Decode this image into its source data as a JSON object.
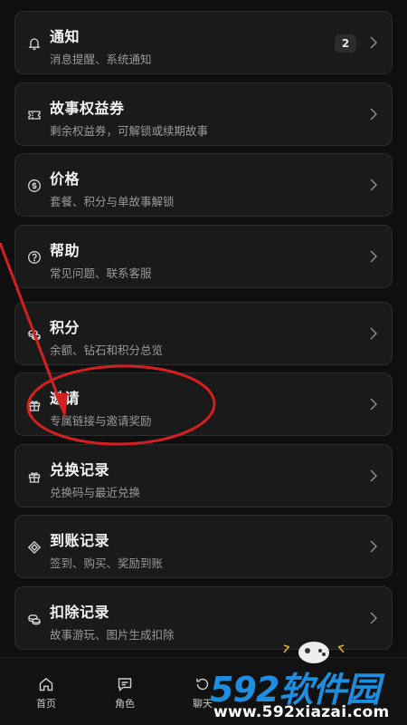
{
  "menu": [
    {
      "title": "通知",
      "subtitle": "消息提醒、系统通知",
      "badge": "2",
      "icon": "bell-icon"
    },
    {
      "title": "故事权益券",
      "subtitle": "剩余权益券，可解锁或续期故事",
      "icon": "ticket-icon"
    },
    {
      "title": "价格",
      "subtitle": "套餐、积分与单故事解锁",
      "icon": "dollar-icon"
    },
    {
      "title": "帮助",
      "subtitle": "常见问题、联系客服",
      "icon": "help-icon"
    },
    {
      "title": "积分",
      "subtitle": "余额、钻石和积分总览",
      "icon": "coins-icon"
    },
    {
      "title": "邀请",
      "subtitle": "专属链接与邀请奖励",
      "icon": "gift-icon"
    },
    {
      "title": "兑换记录",
      "subtitle": "兑换码与最近兑换",
      "icon": "gift-icon"
    },
    {
      "title": "到账记录",
      "subtitle": "签到、购买、奖励到账",
      "icon": "diamond-icon"
    },
    {
      "title": "扣除记录",
      "subtitle": "故事游玩、图片生成扣除",
      "icon": "coins-icon"
    }
  ],
  "tabbar": [
    {
      "label": "首页",
      "icon": "home-icon"
    },
    {
      "label": "角色",
      "icon": "message-icon"
    },
    {
      "label": "聊天",
      "icon": "history-icon"
    }
  ],
  "watermark": {
    "brand": "592软件园",
    "url": "www.592xiazai.com"
  },
  "colors": {
    "annotation_red": "#d42020",
    "watermark_blue": "#1e8fe0"
  }
}
